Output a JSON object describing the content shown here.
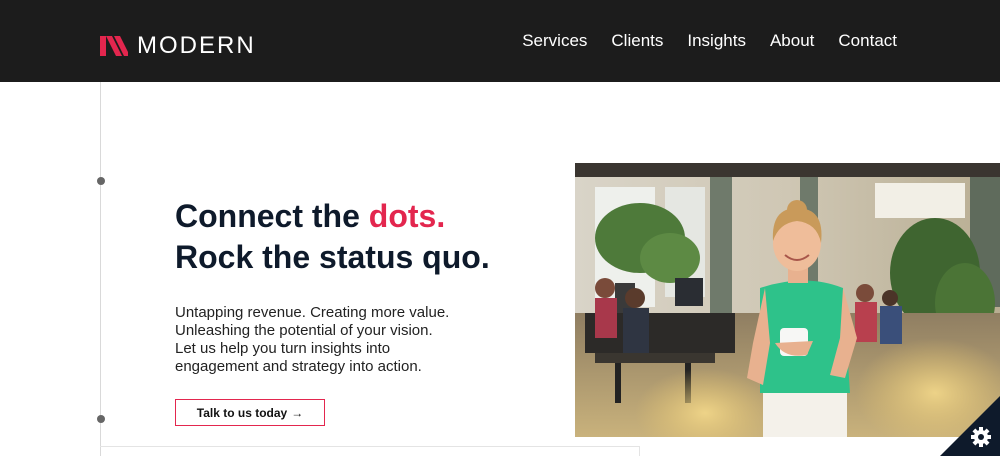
{
  "header": {
    "logo_text": "MODERN",
    "nav": [
      {
        "label": "Services"
      },
      {
        "label": "Clients"
      },
      {
        "label": "Insights"
      },
      {
        "label": "About"
      },
      {
        "label": "Contact"
      }
    ]
  },
  "hero": {
    "headline_line1_prefix": "Connect the ",
    "headline_line1_accent": "dots.",
    "headline_line2": "Rock the status quo.",
    "body_lines": [
      "Untapping revenue. Creating more value.",
      "Unleashing the potential of your vision.",
      "Let us help you turn insights into",
      "engagement and strategy into action."
    ],
    "cta_label": "Talk to us today",
    "cta_arrow": "→"
  },
  "colors": {
    "header_bg": "#1c1c1c",
    "accent": "#e3264e",
    "headline": "#0e1a2b"
  },
  "icons": {
    "logo": "modern-logo-mark",
    "settings": "gear-icon"
  }
}
